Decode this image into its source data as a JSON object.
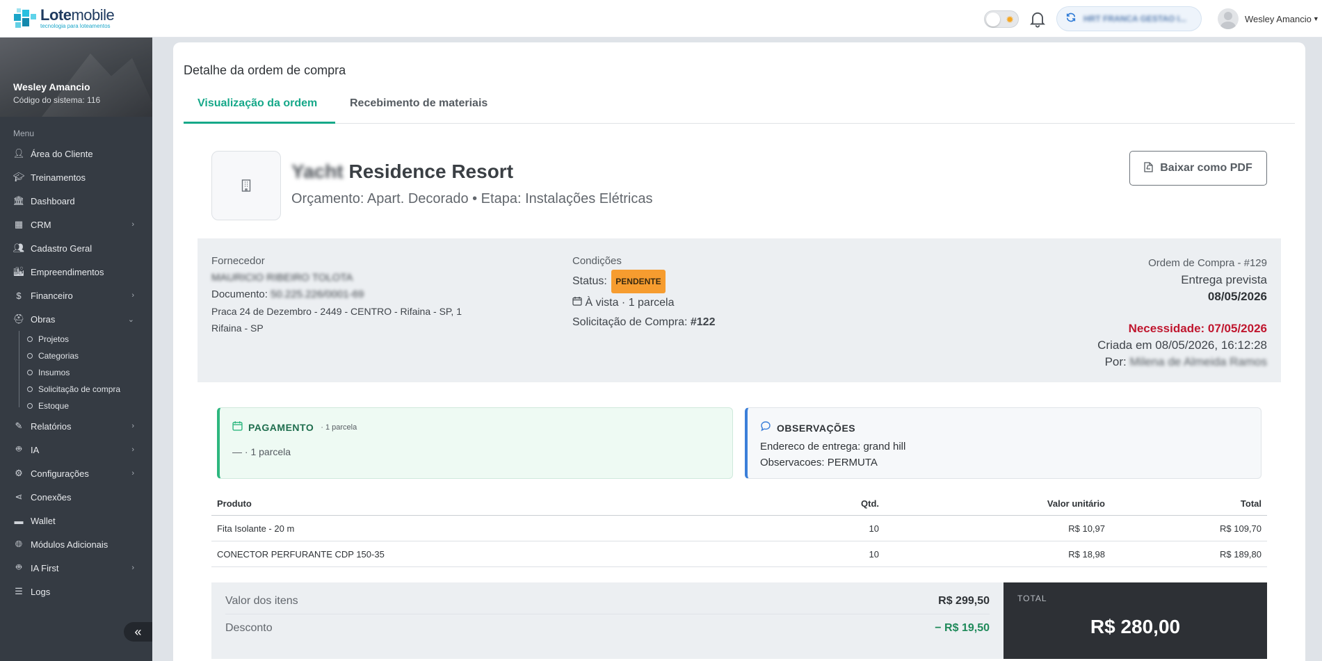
{
  "header": {
    "logo_main": "Lote",
    "logo_light": "mobile",
    "logo_sub": "tecnologia para loteamentos",
    "company_name": "HRT FRANCA GESTAO I...",
    "user_name": "Wesley Amancio"
  },
  "sidebar": {
    "user_name": "Wesley Amancio",
    "system_code": "Código do sistema: 116",
    "menu_title": "Menu",
    "items": [
      {
        "label": "Área do Cliente",
        "icon": "user-icon"
      },
      {
        "label": "Treinamentos",
        "icon": "graduation-icon"
      },
      {
        "label": "Dashboard",
        "icon": "bank-icon"
      },
      {
        "label": "CRM",
        "icon": "table-icon"
      },
      {
        "label": "Cadastro Geral",
        "icon": "users-icon"
      },
      {
        "label": "Empreendimentos",
        "icon": "city-icon"
      },
      {
        "label": "Financeiro",
        "icon": "money-hand-icon"
      },
      {
        "label": "Obras",
        "icon": "hardhat-icon"
      },
      {
        "label": "Relatórios",
        "icon": "report-icon"
      },
      {
        "label": "IA",
        "icon": "robot-icon"
      },
      {
        "label": "Configurações",
        "icon": "gears-icon"
      },
      {
        "label": "Conexões",
        "icon": "share-icon"
      },
      {
        "label": "Wallet",
        "icon": "wallet-icon"
      },
      {
        "label": "Módulos Adicionais",
        "icon": "globe-icon"
      },
      {
        "label": "IA First",
        "icon": "robot-icon"
      },
      {
        "label": "Logs",
        "icon": "list-icon"
      }
    ],
    "obras_sub": [
      "Projetos",
      "Categorias",
      "Insumos",
      "Solicitação de compra",
      "Estoque"
    ]
  },
  "page": {
    "title": "Detalhe da ordem de compra",
    "tabs": [
      "Visualização da ordem",
      "Recebimento de materiais"
    ],
    "project_blur": "Yacht",
    "project_name": "Residence Resort",
    "project_sub": "Orçamento: Apart. Decorado • Etapa: Instalações Elétricas",
    "pdf_button": "Baixar como PDF"
  },
  "info": {
    "fornecedor_label": "Fornecedor",
    "fornecedor_name": "MAURICIO RIBEIRO TOLOTA",
    "documento_label": "Documento:",
    "documento_value": "50.225.226/0001-69",
    "address_line1": "Praca 24 de Dezembro - 2449 - CENTRO - Rifaina - SP, 1",
    "address_line2": "Rifaina - SP",
    "condicoes_label": "Condições",
    "status_label": "Status:",
    "status_value": "PENDENTE",
    "payment_terms": "À vista · 1 parcela",
    "solicitacao_label": "Solicitação de Compra:",
    "solicitacao_value": "#122",
    "ordem": "Ordem de Compra - #129",
    "entrega_label": "Entrega prevista",
    "entrega_date": "08/05/2026",
    "necessidade": "Necessidade: 07/05/2026",
    "criada": "Criada em 08/05/2026, 16:12:28",
    "por_label": "Por:",
    "por_value": "Milena de Almeida Ramos"
  },
  "payment": {
    "title": "PAGAMENTO",
    "subtitle": "· 1 parcela",
    "body": "— · 1 parcela"
  },
  "observacoes": {
    "title": "OBSERVAÇÕES",
    "line1": "Endereco de entrega: grand hill",
    "line2": "Observacoes: PERMUTA"
  },
  "table": {
    "headers": [
      "Produto",
      "Qtd.",
      "Valor unitário",
      "Total"
    ],
    "rows": [
      {
        "produto": "Fita Isolante - 20 m",
        "qtd": "10",
        "unit": "R$ 10,97",
        "total": "R$ 109,70"
      },
      {
        "produto": "CONECTOR PERFURANTE CDP 150-35",
        "qtd": "10",
        "unit": "R$ 18,98",
        "total": "R$ 189,80"
      }
    ]
  },
  "totals": {
    "itens_label": "Valor dos itens",
    "itens_value": "R$ 299,50",
    "desconto_label": "Desconto",
    "desconto_value": "− R$ 19,50",
    "total_label": "TOTAL",
    "total_value": "R$ 280,00"
  }
}
